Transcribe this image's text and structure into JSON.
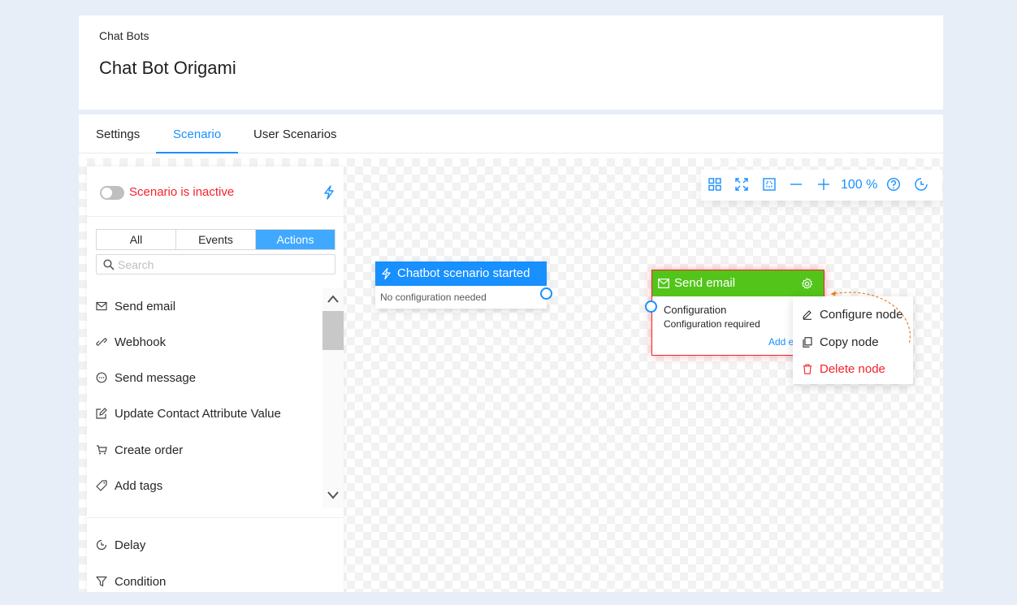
{
  "header": {
    "breadcrumb": "Chat Bots",
    "title": "Chat Bot Origami"
  },
  "tabs": [
    {
      "label": "Settings",
      "active": false
    },
    {
      "label": "Scenario",
      "active": true
    },
    {
      "label": "User Scenarios",
      "active": false
    }
  ],
  "panel": {
    "status_text": "Scenario is inactive",
    "filters": [
      {
        "label": "All",
        "active": false
      },
      {
        "label": "Events",
        "active": false
      },
      {
        "label": "Actions",
        "active": true
      }
    ],
    "search_placeholder": "Search",
    "actions": [
      {
        "label": "Send email",
        "icon": "mail-icon"
      },
      {
        "label": "Webhook",
        "icon": "webhook-icon"
      },
      {
        "label": "Send message",
        "icon": "message-icon"
      },
      {
        "label": "Update Contact Attribute Value",
        "icon": "edit-icon"
      },
      {
        "label": "Create order",
        "icon": "cart-icon"
      },
      {
        "label": "Add tags",
        "icon": "tag-icon"
      }
    ],
    "extra": [
      {
        "label": "Delay",
        "icon": "clock-icon"
      },
      {
        "label": "Condition",
        "icon": "filter-icon"
      }
    ]
  },
  "toolbar": {
    "zoom": "100 %"
  },
  "nodes": {
    "start": {
      "title": "Chatbot scenario started",
      "subtitle": "No configuration needed"
    },
    "email": {
      "title": "Send email",
      "config_label": "Configuration",
      "config_status": "Configuration required",
      "add_link": "Add e"
    }
  },
  "context_menu": [
    {
      "label": "Configure node",
      "icon": "pencil-icon"
    },
    {
      "label": "Copy node",
      "icon": "copy-icon"
    },
    {
      "label": "Delete node",
      "icon": "trash-icon",
      "danger": true
    }
  ],
  "colors": {
    "primary": "#1890ff",
    "success": "#52c41a",
    "danger": "#f5222d",
    "arrow": "#e67e22"
  }
}
